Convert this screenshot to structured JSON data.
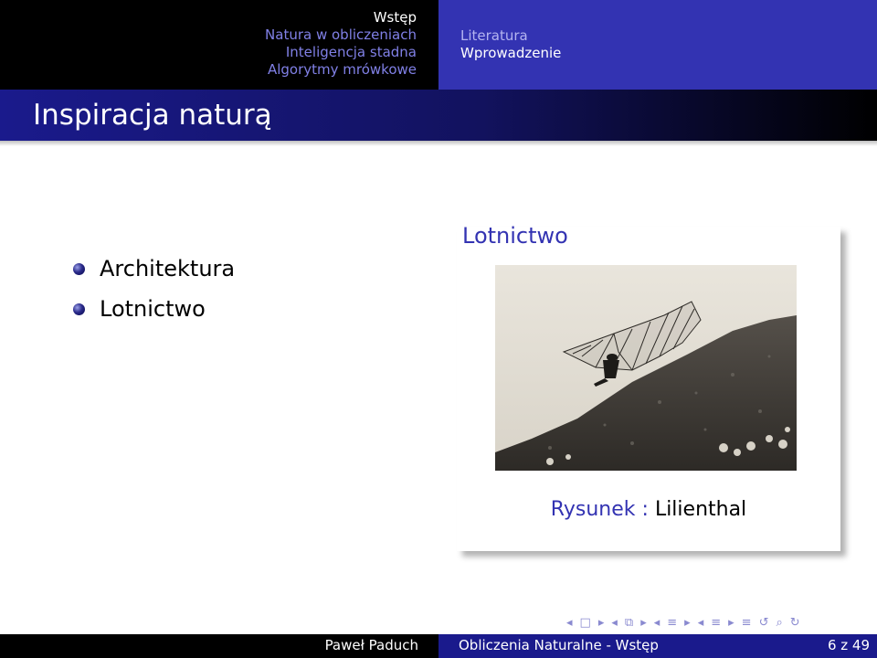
{
  "header": {
    "sections_left": [
      {
        "label": "Wstęp",
        "active": true
      },
      {
        "label": "Natura w obliczeniach",
        "active": false
      },
      {
        "label": "Inteligencja stadna",
        "active": false
      },
      {
        "label": "Algorytmy mrówkowe",
        "active": false
      }
    ],
    "subsections_right": [
      {
        "label": "Literatura",
        "active": false
      },
      {
        "label": "Wprowadzenie",
        "active": true
      }
    ]
  },
  "slide": {
    "title": "Inspiracja naturą",
    "bullets": [
      "Architektura",
      "Lotnictwo"
    ],
    "block": {
      "title": "Lotnictwo",
      "caption_label": "Rysunek :",
      "caption_value": "Lilienthal"
    }
  },
  "footer": {
    "author": "Paweł Paduch",
    "talk_title": "Obliczenia Naturalne - Wstęp",
    "page": "6 z 49"
  },
  "colors": {
    "accent": "#3333b2",
    "header_left_bg": "#000000",
    "header_right_bg": "#3333b2"
  }
}
